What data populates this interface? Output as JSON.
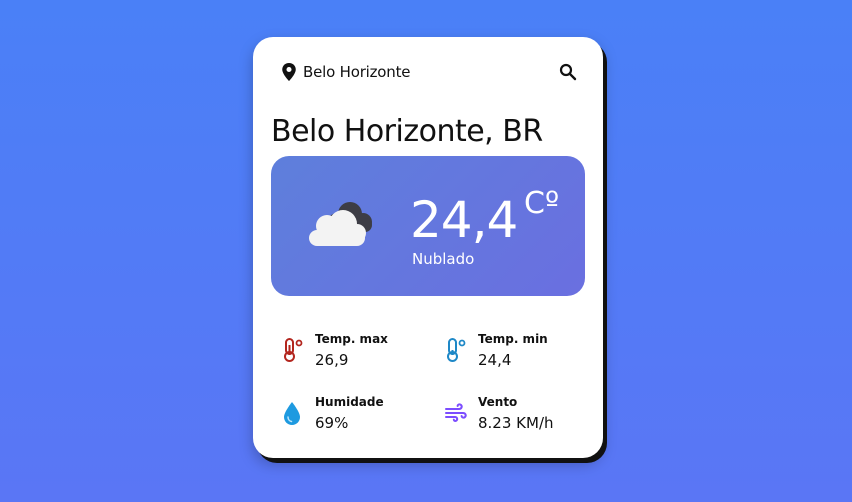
{
  "search": {
    "location_text": "Belo Horizonte",
    "pin_icon": "map-pin-icon",
    "search_icon": "search-icon"
  },
  "city": {
    "title": "Belo Horizonte, BR"
  },
  "current": {
    "temperature": "24,4",
    "unit": "Cº",
    "condition": "Nublado",
    "condition_icon": "cloudy-icon"
  },
  "stats": [
    {
      "label": "Temp. max",
      "value": "26,9",
      "icon": "thermometer-hot-icon",
      "color": "#b3261e"
    },
    {
      "label": "Temp. min",
      "value": "24,4",
      "icon": "thermometer-cold-icon",
      "color": "#1e88c7"
    },
    {
      "label": "Humidade",
      "value": "69%",
      "icon": "water-drop-icon",
      "color": "#1e9ae0"
    },
    {
      "label": "Vento",
      "value": "8.23 KM/h",
      "icon": "wind-icon",
      "color": "#7c4dff"
    }
  ],
  "colors": {
    "background_top": "#4a80f7",
    "background_bottom": "#5a76f5",
    "weather_box": "#6276de",
    "card": "#ffffff"
  }
}
